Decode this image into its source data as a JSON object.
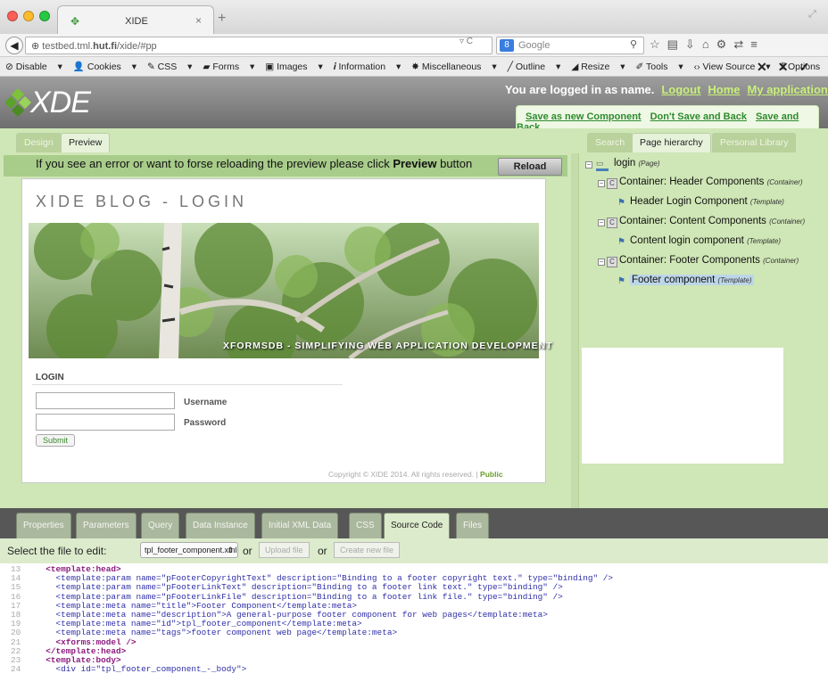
{
  "browser": {
    "tab_title": "XIDE",
    "url_prefix": "testbed.tml.",
    "url_host": "hut.fi",
    "url_path": "/xide/#pp",
    "search_placeholder": "Google",
    "bookmarks": [
      "Disable",
      "Cookies",
      "CSS",
      "Forms",
      "Images",
      "Information",
      "Miscellaneous",
      "Outline",
      "Resize",
      "Tools",
      "View Source",
      "Options"
    ]
  },
  "app": {
    "logo": "XDE",
    "logged_in_text": "You are logged in as name.",
    "links": [
      "Logout",
      "Home",
      "My applications"
    ],
    "save_actions": [
      "Save as new Component",
      "Don't Save and Back",
      "Save and Back"
    ],
    "left_tabs": [
      "Design",
      "Preview"
    ],
    "right_tabs": [
      "Search",
      "Page hierarchy",
      "Personal Library"
    ]
  },
  "preview": {
    "notice_pre": "If you see an error or want to forse reloading the preview please click ",
    "notice_bold": "Preview",
    "notice_post": " button",
    "reload": "Reload",
    "blog_title": "XIDE BLOG - LOGIN",
    "banner_text": "XFORMSDB - SIMPLIFYING WEB APPLICATION DEVELOPMENT",
    "login_heading": "LOGIN",
    "username_label": "Username",
    "password_label": "Password",
    "submit": "Submit",
    "copyright": "Copyright © XIDE 2014. All rights reserved. | ",
    "copyright_link": "Public"
  },
  "hierarchy": {
    "root": {
      "label": "login",
      "type": "(Page)"
    },
    "containers": [
      {
        "label": "Container: Header Components",
        "type": "(Container)",
        "child": {
          "label": "Header Login Component",
          "type": "(Template)"
        }
      },
      {
        "label": "Container: Content Components",
        "type": "(Container)",
        "child": {
          "label": "Content login component",
          "type": "(Template)"
        }
      },
      {
        "label": "Container: Footer Components",
        "type": "(Container)",
        "child": {
          "label": "Footer component",
          "type": "(Template)"
        }
      }
    ]
  },
  "bottom": {
    "tabs": [
      "Properties",
      "Parameters",
      "Query",
      "Data Instance",
      "Initial XML Data",
      "CSS",
      "Source Code",
      "Files"
    ],
    "select_label": "Select the file to edit:",
    "selected_file": "tpl_footer_component.xml",
    "or1": "or",
    "upload": "Upload file",
    "or2": "or",
    "create": "Create new file"
  },
  "code": [
    {
      "n": "13",
      "t": "  <template:head>"
    },
    {
      "n": "14",
      "t": "    <template:param name=\"pFooterCopyrightText\" description=\"Binding to a footer copyright text.\" type=\"binding\" />"
    },
    {
      "n": "15",
      "t": "    <template:param name=\"pFooterLinkText\" description=\"Binding to a footer link text.\" type=\"binding\" />"
    },
    {
      "n": "16",
      "t": "    <template:param name=\"pFooterLinkFile\" description=\"Binding to a footer link file.\" type=\"binding\" />"
    },
    {
      "n": "17",
      "t": "    <template:meta name=\"title\">Footer Component</template:meta>"
    },
    {
      "n": "18",
      "t": "    <template:meta name=\"description\">A general-purpose footer component for web pages</template:meta>"
    },
    {
      "n": "19",
      "t": "    <template:meta name=\"id\">tpl_footer_component</template:meta>"
    },
    {
      "n": "20",
      "t": "    <template:meta name=\"tags\">footer component web page</template:meta>"
    },
    {
      "n": "21",
      "t": "    <xforms:model />"
    },
    {
      "n": "22",
      "t": "  </template:head>"
    },
    {
      "n": "23",
      "t": "  <template:body>"
    },
    {
      "n": "24",
      "t": "    <div id=\"tpl_footer_component_-_body\">"
    }
  ]
}
